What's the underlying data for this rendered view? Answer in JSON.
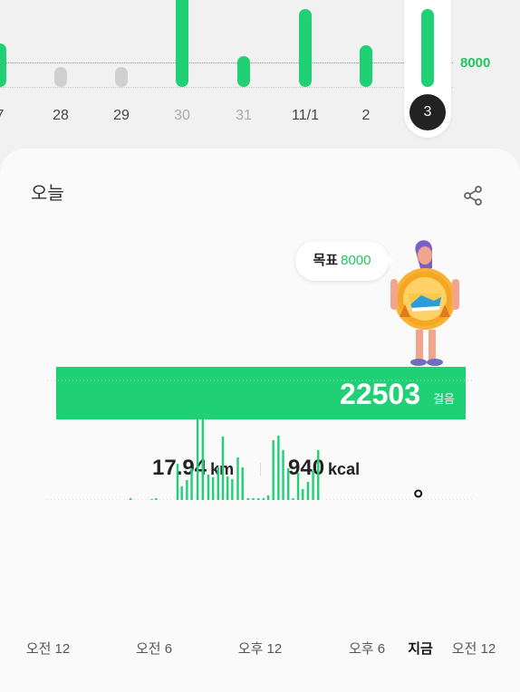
{
  "weekly_chart": {
    "days": [
      {
        "label": "7",
        "value": 5600,
        "dim": false
      },
      {
        "label": "28",
        "value": 1000,
        "dim": false
      },
      {
        "label": "29",
        "value": 900,
        "dim": false
      },
      {
        "label": "30",
        "value": 12500,
        "dim": true
      },
      {
        "label": "31",
        "value": 4000,
        "dim": true
      },
      {
        "label": "11/1",
        "value": 10000,
        "dim": false
      },
      {
        "label": "2",
        "value": 5300,
        "dim": false
      },
      {
        "label": "3",
        "value": 10000,
        "dim": false,
        "selected": true
      }
    ],
    "goal_label": "8000",
    "colors": {
      "achieved": "#1fd074",
      "below": "#cfcfcf"
    }
  },
  "today": {
    "title": "오늘",
    "goal_prefix": "목표",
    "goal_value": "8000",
    "steps": "22503",
    "steps_unit": "걸음",
    "distance_value": "17.94",
    "distance_unit": "km",
    "calories_value": "940",
    "calories_unit": "kcal"
  },
  "hourly_chart": {
    "time_labels": [
      "오전 12",
      "오전 6",
      "오후 12",
      "오후 6",
      "지금",
      "오전 12"
    ],
    "bars": [
      {
        "t": 0.195,
        "v": 2
      },
      {
        "t": 0.245,
        "v": 1
      },
      {
        "t": 0.255,
        "v": 2
      },
      {
        "t": 0.305,
        "v": 40
      },
      {
        "t": 0.315,
        "v": 15
      },
      {
        "t": 0.327,
        "v": 22
      },
      {
        "t": 0.338,
        "v": 35
      },
      {
        "t": 0.352,
        "v": 95
      },
      {
        "t": 0.364,
        "v": 90
      },
      {
        "t": 0.377,
        "v": 28
      },
      {
        "t": 0.388,
        "v": 25
      },
      {
        "t": 0.4,
        "v": 36
      },
      {
        "t": 0.411,
        "v": 70
      },
      {
        "t": 0.422,
        "v": 26
      },
      {
        "t": 0.433,
        "v": 23
      },
      {
        "t": 0.446,
        "v": 47
      },
      {
        "t": 0.457,
        "v": 36
      },
      {
        "t": 0.47,
        "v": 2
      },
      {
        "t": 0.482,
        "v": 2
      },
      {
        "t": 0.494,
        "v": 2
      },
      {
        "t": 0.506,
        "v": 2
      },
      {
        "t": 0.517,
        "v": 5
      },
      {
        "t": 0.529,
        "v": 66
      },
      {
        "t": 0.541,
        "v": 71
      },
      {
        "t": 0.552,
        "v": 55
      },
      {
        "t": 0.564,
        "v": 35
      },
      {
        "t": 0.575,
        "v": 2
      },
      {
        "t": 0.587,
        "v": 30
      },
      {
        "t": 0.598,
        "v": 12
      },
      {
        "t": 0.61,
        "v": 20
      },
      {
        "t": 0.622,
        "v": 32
      },
      {
        "t": 0.634,
        "v": 55
      }
    ],
    "now_position": 0.868
  }
}
